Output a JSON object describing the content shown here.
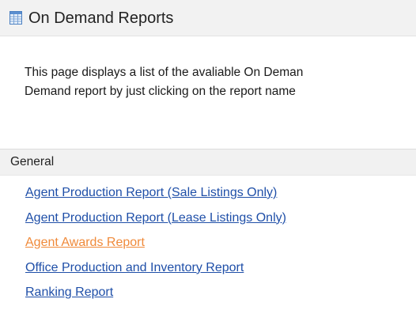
{
  "header": {
    "title": "On Demand Reports",
    "icon": "report-table-icon"
  },
  "intro": {
    "line1": "This page displays a list of the avaliable On Deman",
    "line2": "Demand report by just clicking on the report name"
  },
  "section": {
    "label": "General"
  },
  "reports": [
    {
      "label": "Agent Production Report (Sale Listings Only)"
    },
    {
      "label": "Agent Production Report (Lease Listings Only)"
    },
    {
      "label": "Agent Awards Report"
    },
    {
      "label": "Office Production and Inventory Report"
    },
    {
      "label": "Ranking Report"
    }
  ],
  "colors": {
    "link": "#1f4fa8",
    "link_highlight": "#f08a3a",
    "header_bg": "#f2f2f2",
    "section_bg": "#f1f1f1"
  }
}
